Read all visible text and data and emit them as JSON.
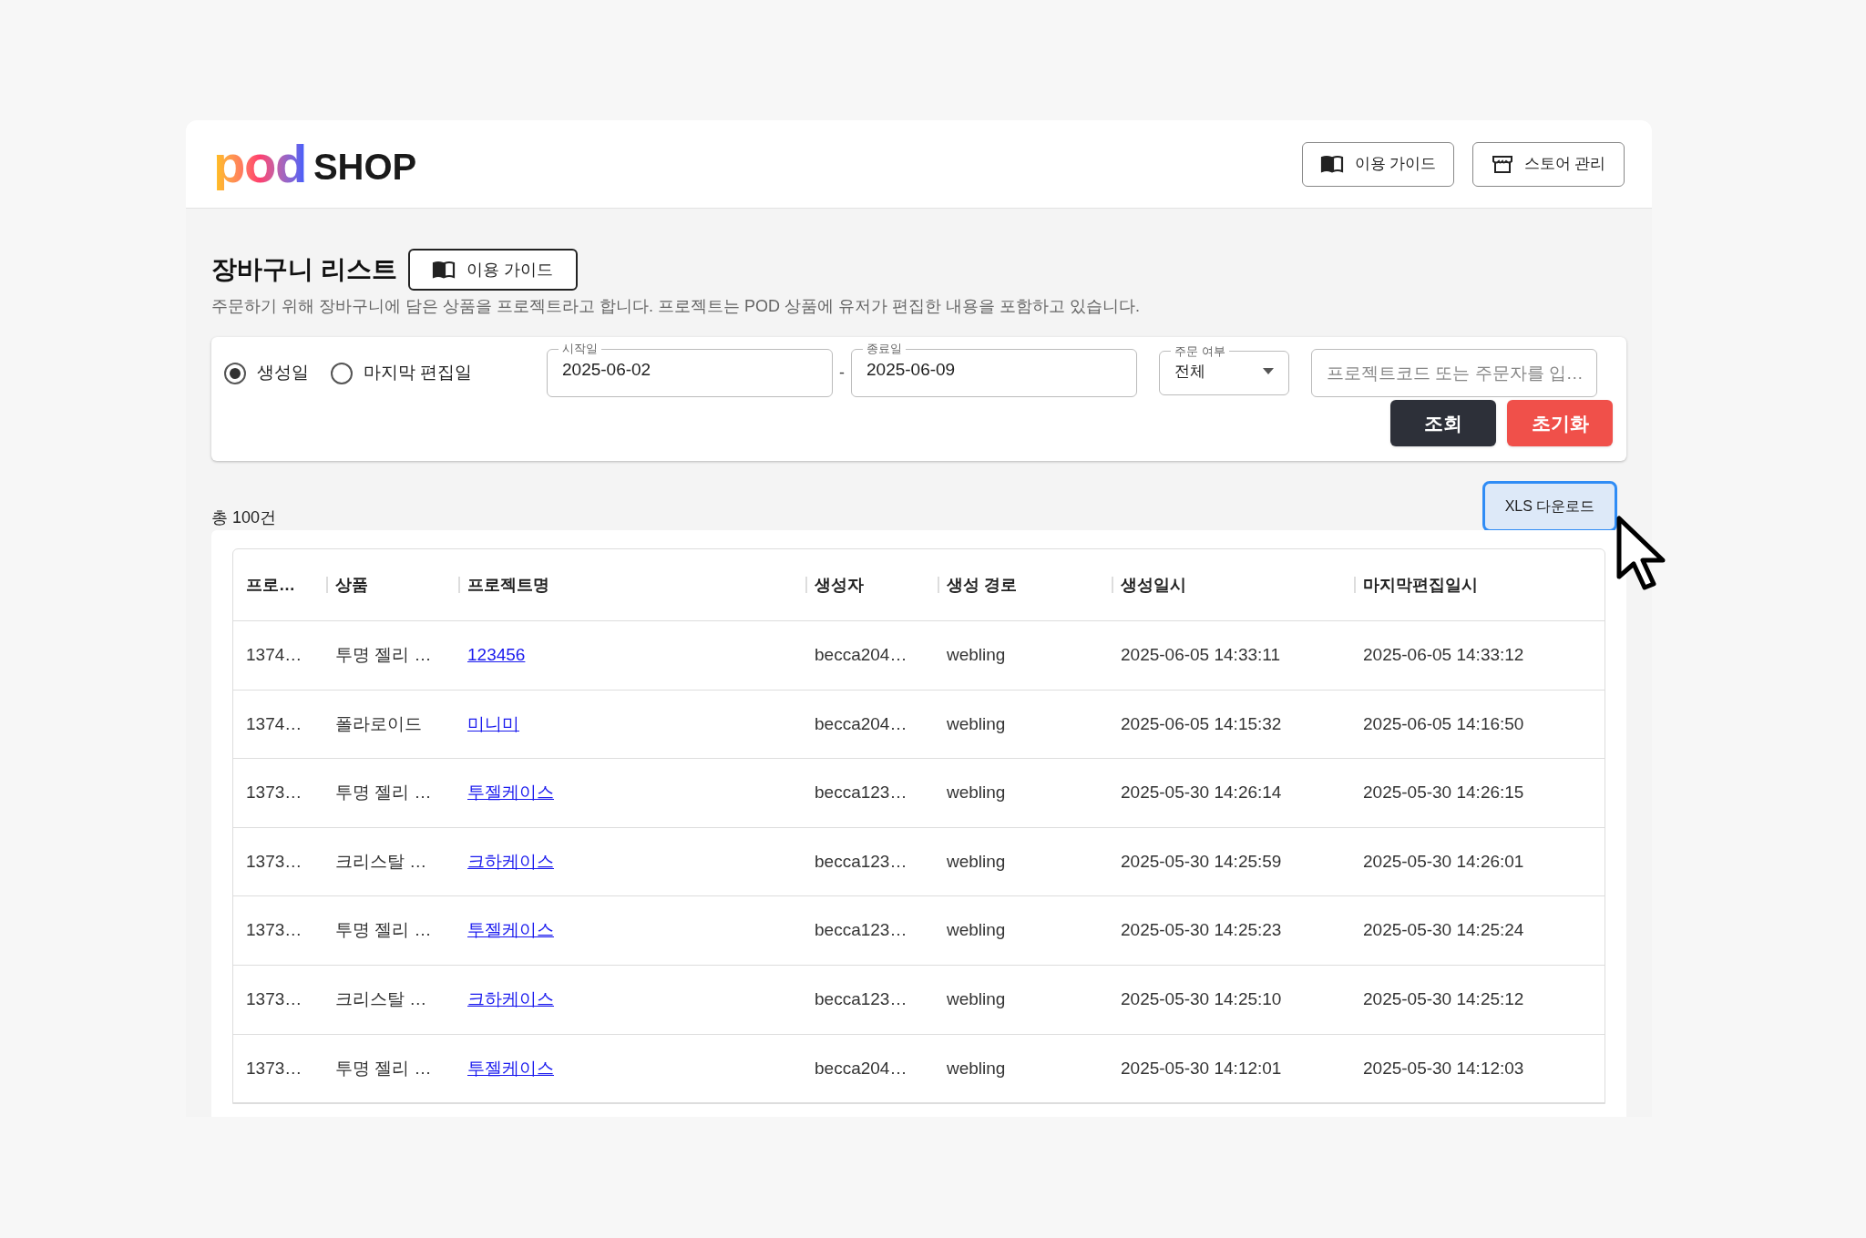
{
  "header": {
    "logo": {
      "mark": "pod",
      "name": "SHOP"
    },
    "buttons": [
      {
        "kind": "guide",
        "label": "이용 가이드"
      },
      {
        "kind": "store",
        "label": "스토어 관리"
      }
    ]
  },
  "page": {
    "title": "장바구니 리스트",
    "guide_button": "이용 가이드",
    "description": "주문하기 위해 장바구니에 담은 상품을 프로젝트라고 합니다. 프로젝트는 POD 상품에 유저가 편집한 내용을 포함하고 있습니다."
  },
  "filters": {
    "date_type": [
      {
        "label": "생성일",
        "selected": true
      },
      {
        "label": "마지막 편집일",
        "selected": false
      }
    ],
    "start": {
      "label": "시작일",
      "value": "2025-06-02"
    },
    "separator": "-",
    "end": {
      "label": "종료일",
      "value": "2025-06-09"
    },
    "order": {
      "label": "주문 여부",
      "value": "전체"
    },
    "search": {
      "placeholder": "프로젝트코드 또는 주문자를 입…"
    },
    "search_button": "조회",
    "reset_button": "초기화"
  },
  "total": "총 100건",
  "download_button": "XLS 다운로드",
  "table": {
    "columns": [
      "프로…",
      "상품",
      "프로젝트명",
      "생성자",
      "생성 경로",
      "생성일시",
      "마지막편집일시"
    ],
    "rows": [
      [
        "1374…",
        "투명 젤리 …",
        "123456",
        "becca204…",
        "webling",
        "2025-06-05 14:33:11",
        "2025-06-05 14:33:12"
      ],
      [
        "1374…",
        "폴라로이드",
        "미니미",
        "becca204…",
        "webling",
        "2025-06-05 14:15:32",
        "2025-06-05 14:16:50"
      ],
      [
        "1373…",
        "투명 젤리 …",
        "투젤케이스",
        "becca123…",
        "webling",
        "2025-05-30 14:26:14",
        "2025-05-30 14:26:15"
      ],
      [
        "1373…",
        "크리스탈 …",
        "크하케이스",
        "becca123…",
        "webling",
        "2025-05-30 14:25:59",
        "2025-05-30 14:26:01"
      ],
      [
        "1373…",
        "투명 젤리 …",
        "투젤케이스",
        "becca123…",
        "webling",
        "2025-05-30 14:25:23",
        "2025-05-30 14:25:24"
      ],
      [
        "1373…",
        "크리스탈 …",
        "크하케이스",
        "becca123…",
        "webling",
        "2025-05-30 14:25:10",
        "2025-05-30 14:25:12"
      ],
      [
        "1373…",
        "투명 젤리 …",
        "투젤케이스",
        "becca204…",
        "webling",
        "2025-05-30 14:12:01",
        "2025-05-30 14:12:03"
      ]
    ]
  }
}
